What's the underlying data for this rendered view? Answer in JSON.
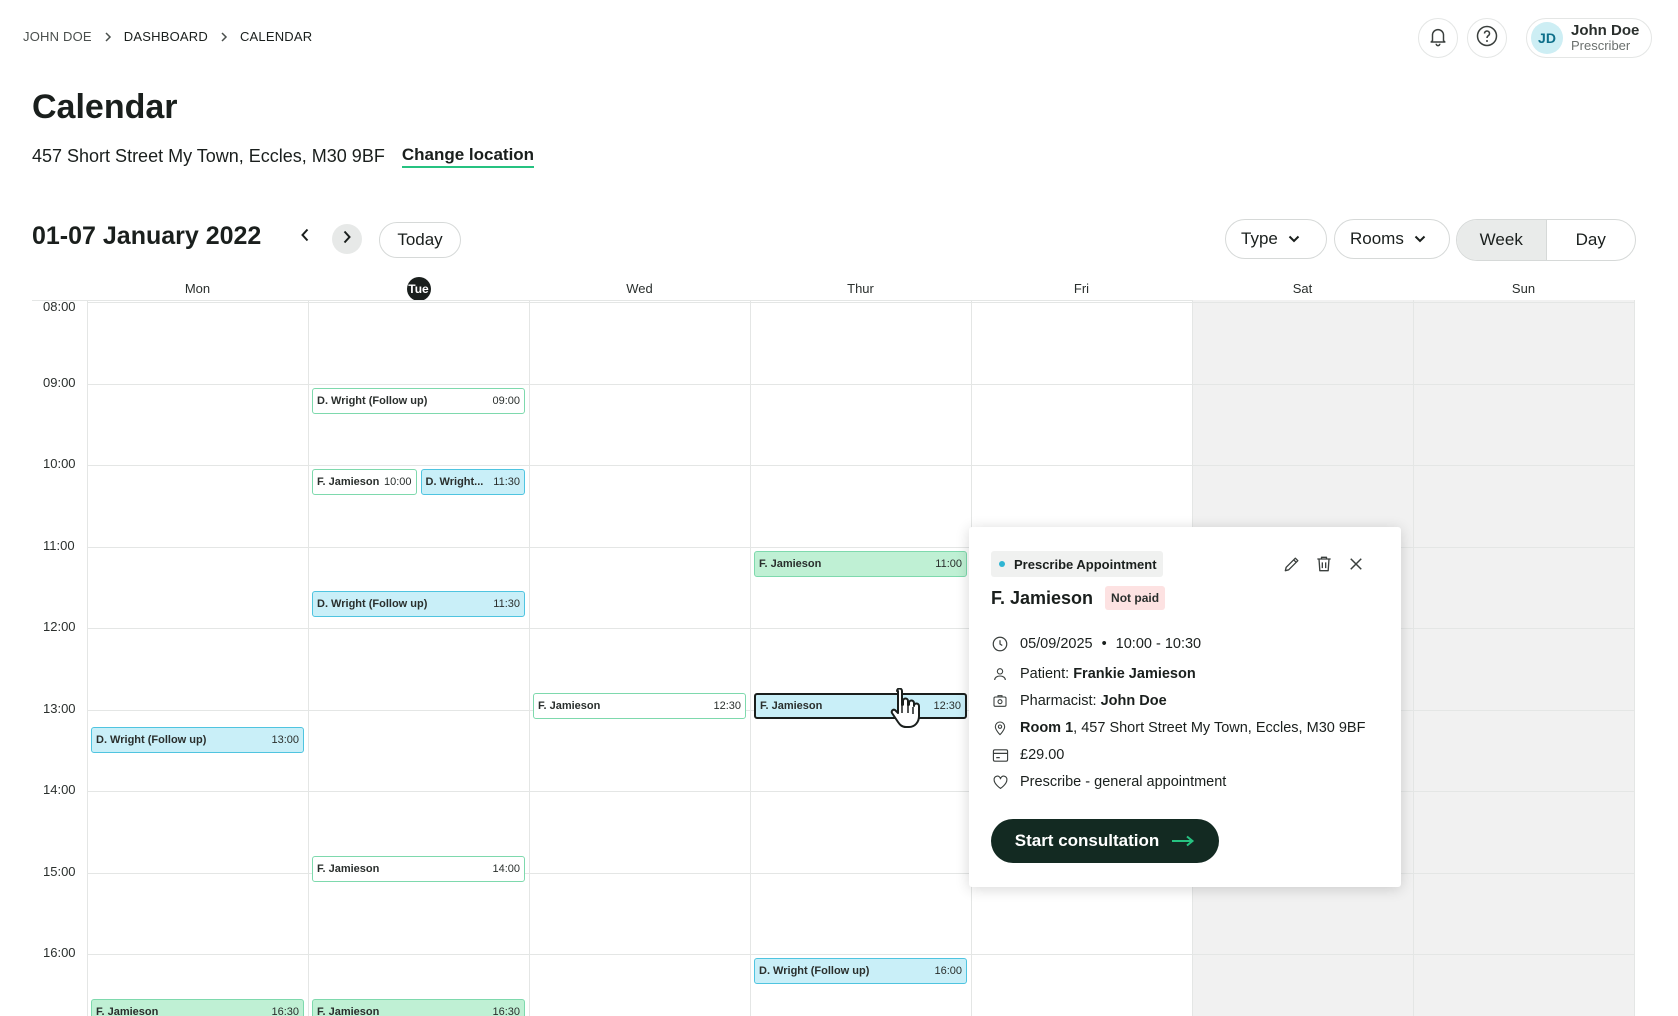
{
  "breadcrumb": {
    "items": [
      "JOHN DOE",
      "DASHBOARD",
      "CALENDAR"
    ]
  },
  "header": {
    "user": {
      "initials": "JD",
      "name": "John Doe",
      "role": "Prescriber"
    }
  },
  "page": {
    "title": "Calendar",
    "location": "457 Short Street My Town, Eccles, M30 9BF",
    "change_location": "Change location"
  },
  "toolbar": {
    "range": "01-07 January 2022",
    "today": "Today",
    "type_filter": "Type",
    "rooms_filter": "Rooms",
    "view_week": "Week",
    "view_day": "Day",
    "active_view": "Week"
  },
  "calendar": {
    "days": [
      "Mon",
      "Tue",
      "Wed",
      "Thur",
      "Fri",
      "Sat",
      "Sun"
    ],
    "today_day": "Tue",
    "times": [
      "08:00",
      "09:00",
      "10:00",
      "11:00",
      "12:00",
      "13:00",
      "14:00",
      "15:00",
      "16:00"
    ],
    "events": [
      {
        "day": "Tue",
        "name": "D. Wright (Follow up)",
        "time": "09:00",
        "style": "white"
      },
      {
        "day": "Tue",
        "name": "F. Jamieson",
        "time": "10:00",
        "style": "white",
        "half": "left"
      },
      {
        "day": "Tue",
        "name": "D. Wright...",
        "time": "11:30",
        "style": "blue",
        "half": "right",
        "slot": "10:00"
      },
      {
        "day": "Tue",
        "name": "D. Wright (Follow up)",
        "time": "11:30",
        "style": "blue"
      },
      {
        "day": "Tue",
        "name": "F. Jamieson",
        "time": "14:00",
        "style": "white",
        "slot": "14:45"
      },
      {
        "day": "Tue",
        "name": "F. Jamieson",
        "time": "16:30",
        "style": "green"
      },
      {
        "day": "Mon",
        "name": "D. Wright (Follow up)",
        "time": "13:00",
        "style": "blue",
        "slot": "13:10"
      },
      {
        "day": "Mon",
        "name": "F. Jamieson",
        "time": "16:30",
        "style": "green"
      },
      {
        "day": "Wed",
        "name": "F. Jamieson",
        "time": "12:30",
        "style": "white",
        "slot": "12:45"
      },
      {
        "day": "Thur",
        "name": "F. Jamieson",
        "time": "11:00",
        "style": "green"
      },
      {
        "day": "Thur",
        "name": "F. Jamieson",
        "time": "12:30",
        "style": "selected",
        "slot": "12:45"
      },
      {
        "day": "Thur",
        "name": "D. Wright (Follow up)",
        "time": "16:00",
        "style": "blue"
      }
    ]
  },
  "popover": {
    "type": "Prescribe Appointment",
    "patient_short": "F. Jamieson",
    "payment_status": "Not paid",
    "date": "05/09/2025",
    "time_range": "10:00 - 10:30",
    "patient_label": "Patient:",
    "patient_name": "Frankie Jamieson",
    "pharmacist_label": "Pharmacist:",
    "pharmacist_name": "John Doe",
    "room": "Room 1",
    "address": ", 457 Short Street My Town, Eccles, M30 9BF",
    "price": "£29.00",
    "service": "Prescribe - general appointment",
    "cta": "Start consultation",
    "colors": {
      "cta_bg": "#132a22",
      "cta_arrow": "#26c281",
      "badge_bg": "#fde2e2",
      "tag_dot": "#2fb5d3"
    }
  }
}
